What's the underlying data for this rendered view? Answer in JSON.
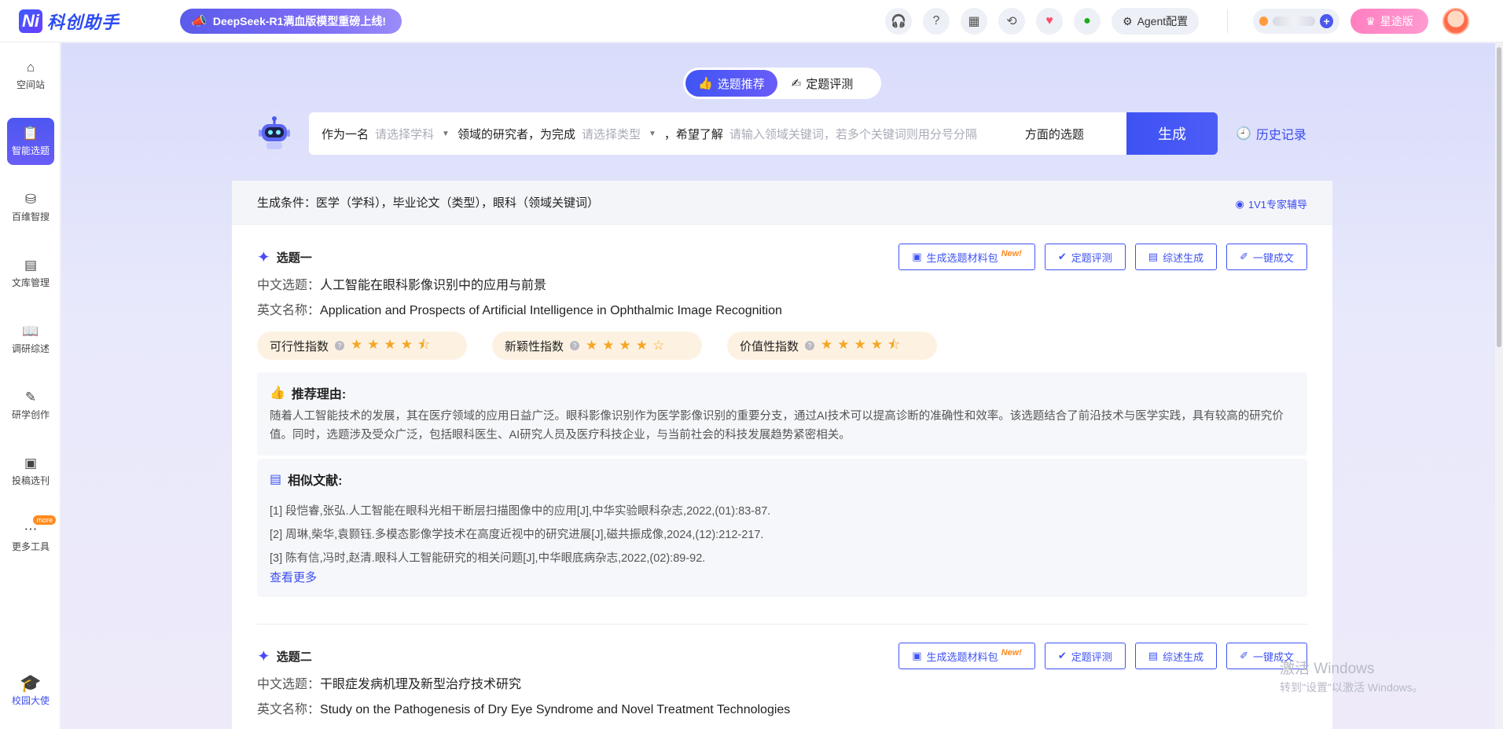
{
  "app": {
    "logo_mark": "Ni",
    "name": "科创助手",
    "promo": "DeepSeek-R1满血版模型重磅上线!",
    "agent_label": "Agent配置",
    "vip_label": "星途版"
  },
  "sidebar": {
    "items": [
      {
        "label": "空间站",
        "icon": "home-icon"
      },
      {
        "label": "智能选题",
        "icon": "clipboard-icon"
      },
      {
        "label": "百维智搜",
        "icon": "search-db-icon"
      },
      {
        "label": "文库管理",
        "icon": "library-icon"
      },
      {
        "label": "调研综述",
        "icon": "book-icon"
      },
      {
        "label": "研学创作",
        "icon": "edit-icon"
      },
      {
        "label": "投稿选刊",
        "icon": "journal-icon"
      },
      {
        "label": "更多工具",
        "icon": "more-icon"
      }
    ],
    "more_badge": "more",
    "bottom": "校园大使"
  },
  "tabs": [
    "选题推荐",
    "定题评测"
  ],
  "generator": {
    "p1": "作为一名",
    "subject_placeholder": "请选择学科",
    "p2": "领域的研究者，为完成",
    "type_placeholder": "请选择类型",
    "p3": "，希望了解",
    "keyword_placeholder": "请输入领域关键词，若多个关键词则用分号分隔",
    "p4": "方面的选题",
    "button": "生成",
    "history": "历史记录"
  },
  "conditions": {
    "text": "生成条件：医学（学科），毕业论文（类型），眼科（领域关键词）",
    "expert": "1V1专家辅导"
  },
  "actions": {
    "material": "生成选题材料包",
    "new_tag": "New!",
    "evaluate": "定题评测",
    "review": "综述生成",
    "oneclick": "一键成文"
  },
  "topics": [
    {
      "title": "选题一",
      "cn_label": "中文选题：",
      "cn": "人工智能在眼科影像识别中的应用与前景",
      "en_label": "英文名称：",
      "en": "Application and Prospects of Artificial Intelligence in Ophthalmic Image Recognition",
      "scores": [
        {
          "label": "可行性指数",
          "stars": "★★★★⯪",
          "rating": 4.5
        },
        {
          "label": "新颖性指数",
          "stars": "★★★★☆",
          "rating": 4
        },
        {
          "label": "价值性指数",
          "stars": "★★★★⯪",
          "rating": 4.5
        }
      ],
      "reason_title": "推荐理由:",
      "reason": "随着人工智能技术的发展，其在医疗领域的应用日益广泛。眼科影像识别作为医学影像识别的重要分支，通过AI技术可以提高诊断的准确性和效率。该选题结合了前沿技术与医学实践，具有较高的研究价值。同时，选题涉及受众广泛，包括眼科医生、AI研究人员及医疗科技企业，与当前社会的科技发展趋势紧密相关。",
      "refs_title": "相似文献:",
      "refs": [
        "[1] 段恺睿,张弘.人工智能在眼科光相干断层扫描图像中的应用[J],中华实验眼科杂志,2022,(01):83-87.",
        "[2] 周琳,柴华,袁颢钰.多模态影像学技术在高度近视中的研究进展[J],磁共振成像,2024,(12):212-217.",
        "[3] 陈有信,冯时,赵清.眼科人工智能研究的相关问题[J],中华眼底病杂志,2022,(02):89-92."
      ],
      "more": "查看更多"
    },
    {
      "title": "选题二",
      "cn_label": "中文选题：",
      "cn": "干眼症发病机理及新型治疗技术研究",
      "en_label": "英文名称：",
      "en": "Study on the Pathogenesis of Dry Eye Syndrome and Novel Treatment Technologies"
    }
  ],
  "watermark": {
    "line1": "激活 Windows",
    "line2": "转到\"设置\"以激活 Windows。"
  }
}
